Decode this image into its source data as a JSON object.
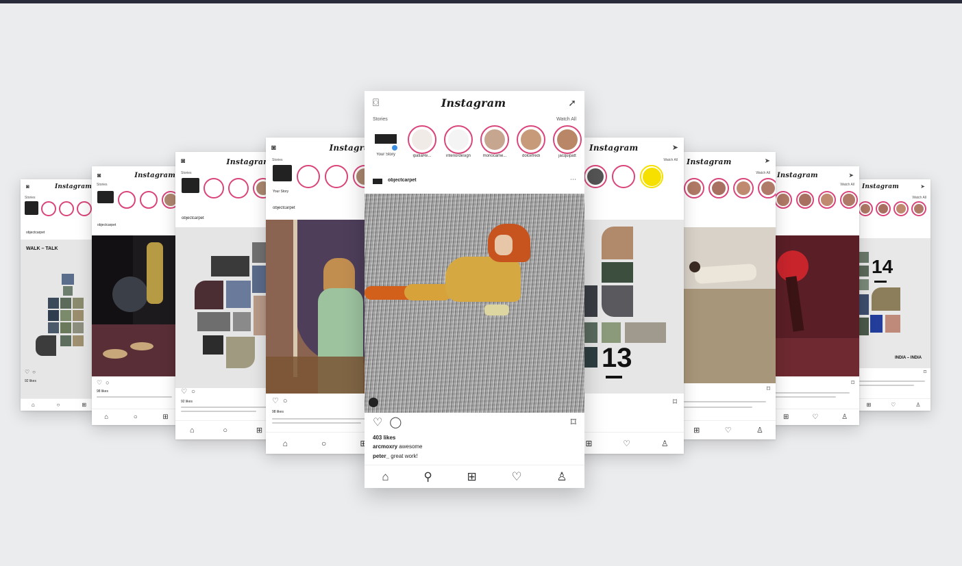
{
  "colors": {
    "background": "#ebecee",
    "top_bar": "#2a2b3a",
    "story_ring": "#d9447a"
  },
  "center_phone": {
    "wordmark": "Instagram",
    "stories_label": "Stories",
    "watch_all": "Watch All",
    "stories": [
      {
        "label": "Your Story"
      },
      {
        "label": "ipatiaRe..."
      },
      {
        "label": "interiordesign"
      },
      {
        "label": "monocame..."
      },
      {
        "label": "dolcefredi"
      },
      {
        "label": "jacquipatt"
      }
    ],
    "post_user": "objectcarpet",
    "likes": "403 likes",
    "comment_1_user": "arcmoxry",
    "comment_1_text": "awesome",
    "comment_2_user": "peter_",
    "comment_2_text": "great work!",
    "icons": {
      "camera": "camera-icon",
      "send": "send-icon",
      "heart": "heart-icon",
      "comment": "comment-icon",
      "bookmark": "bookmark-icon",
      "home": "home-icon",
      "search": "search-icon",
      "add": "add-icon",
      "activity": "heart-icon",
      "profile": "profile-icon"
    }
  },
  "side_phones": {
    "wordmark": "Instagram",
    "stories_label": "Stories",
    "watch_all": "Watch All",
    "post_user": "objectcarpet",
    "labels": {
      "walk_talk": "WALK – TALK",
      "number_13": "13",
      "number_14": "14",
      "india_india": "INDIA – INDIA",
      "your_story": "Your Story",
      "likes_short": "92 likes",
      "likes_alt": "98 likes"
    }
  }
}
